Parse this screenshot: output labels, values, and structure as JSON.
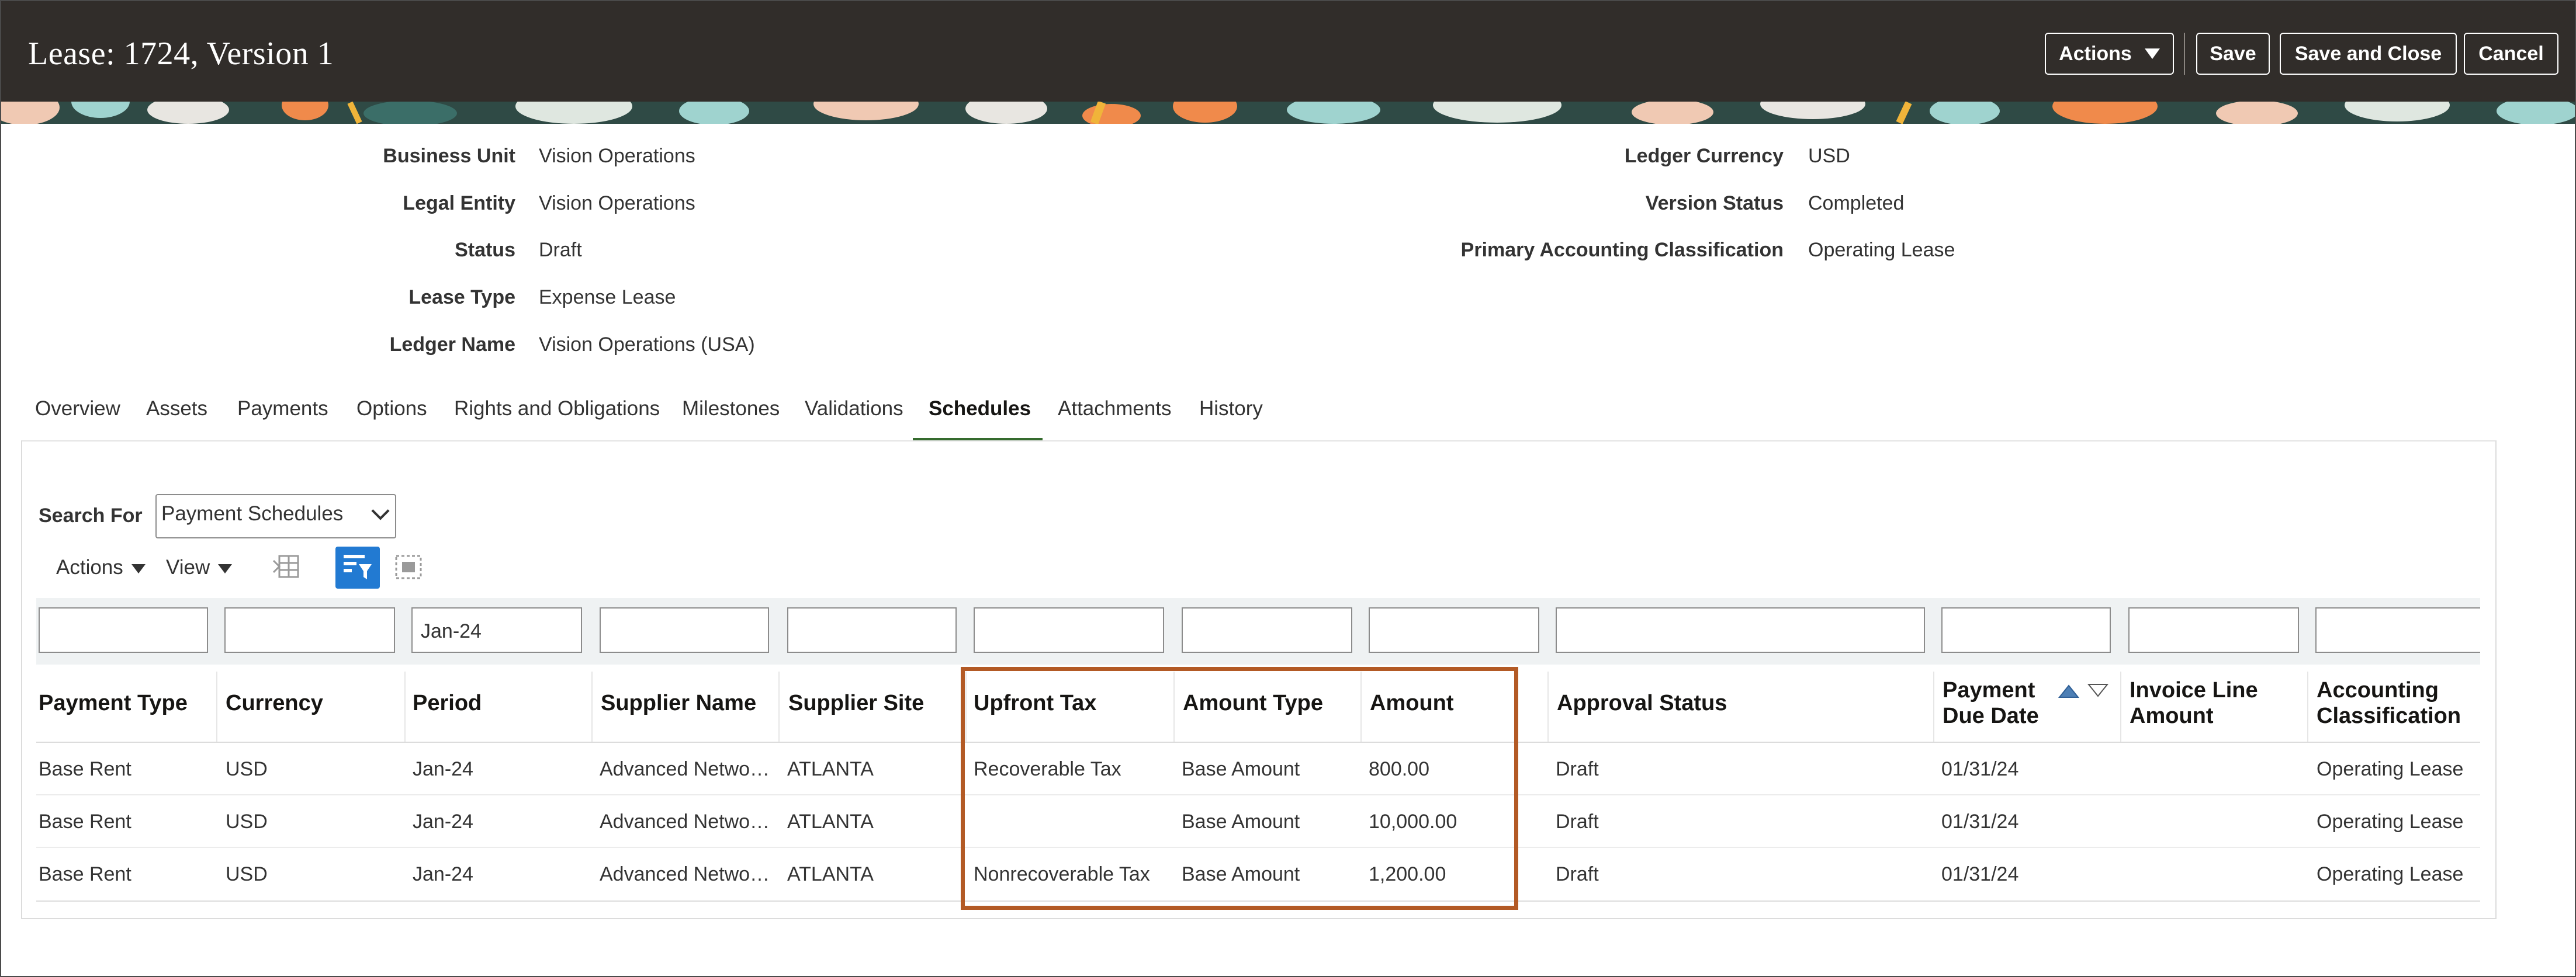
{
  "header": {
    "title": "Lease: 1724, Version 1",
    "actions_label": "Actions",
    "save_label": "Save",
    "save_close_label": "Save and Close",
    "cancel_label": "Cancel"
  },
  "details_left": [
    {
      "label": "Business Unit",
      "value": "Vision Operations"
    },
    {
      "label": "Legal Entity",
      "value": "Vision Operations"
    },
    {
      "label": "Status",
      "value": "Draft"
    },
    {
      "label": "Lease Type",
      "value": "Expense Lease"
    },
    {
      "label": "Ledger Name",
      "value": "Vision Operations (USA)"
    }
  ],
  "details_right": [
    {
      "label": "Ledger Currency",
      "value": "USD"
    },
    {
      "label": "Version Status",
      "value": "Completed"
    },
    {
      "label": "Primary Accounting Classification",
      "value": "Operating Lease"
    }
  ],
  "tabs": [
    {
      "label": "Overview"
    },
    {
      "label": "Assets"
    },
    {
      "label": "Payments"
    },
    {
      "label": "Options"
    },
    {
      "label": "Rights and Obligations"
    },
    {
      "label": "Milestones"
    },
    {
      "label": "Validations"
    },
    {
      "label": "Schedules",
      "active": true
    },
    {
      "label": "Attachments"
    },
    {
      "label": "History"
    }
  ],
  "search": {
    "label": "Search For",
    "selected": "Payment Schedules"
  },
  "toolbar": {
    "actions_label": "Actions",
    "view_label": "View"
  },
  "table": {
    "filters": [
      "",
      "",
      "Jan-24",
      "",
      "",
      "",
      "",
      "",
      "",
      "",
      "",
      ""
    ],
    "headers": [
      {
        "line1": "Payment Type"
      },
      {
        "line1": "Currency"
      },
      {
        "line1": "Period"
      },
      {
        "line1": "Supplier Name"
      },
      {
        "line1": "Supplier Site"
      },
      {
        "line1": "Upfront Tax"
      },
      {
        "line1": "Amount Type"
      },
      {
        "line1": "Amount"
      },
      {
        "line1": "Approval Status"
      },
      {
        "line1": "Payment",
        "line2": "Due Date"
      },
      {
        "line1": "Invoice Line",
        "line2": "Amount"
      },
      {
        "line1": "Accounting",
        "line2": "Classification"
      }
    ],
    "rows": [
      [
        "Base Rent",
        "USD",
        "Jan-24",
        "Advanced Netwo…",
        "ATLANTA",
        "Recoverable Tax",
        "Base Amount",
        "800.00",
        "Draft",
        "01/31/24",
        "",
        "Operating Lease"
      ],
      [
        "Base Rent",
        "USD",
        "Jan-24",
        "Advanced Netwo…",
        "ATLANTA",
        "",
        "Base Amount",
        "10,000.00",
        "Draft",
        "01/31/24",
        "",
        "Operating Lease"
      ],
      [
        "Base Rent",
        "USD",
        "Jan-24",
        "Advanced Netwo…",
        "ATLANTA",
        "Nonrecoverable Tax",
        "Base Amount",
        "1,200.00",
        "Draft",
        "01/31/24",
        "",
        "Operating Lease"
      ]
    ]
  },
  "colors": {
    "header_bg": "#312d2a",
    "highlight_border": "#b35a25",
    "active_tab_underline": "#356b2e",
    "primary_blue": "#227ad2"
  }
}
